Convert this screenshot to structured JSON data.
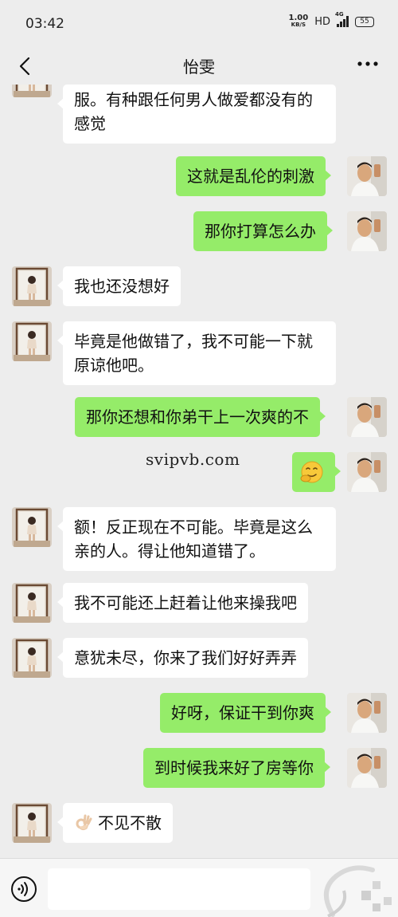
{
  "status": {
    "time": "03:42",
    "net_speed_value": "1.00",
    "net_speed_unit": "KB/S",
    "hd": "HD",
    "network": "4G",
    "battery": "55"
  },
  "header": {
    "title": "怡雯",
    "back_icon": "chevron-left-icon",
    "more_icon": "more-dots-icon"
  },
  "messages": [
    {
      "side": "left",
      "lines": [
        "服。有种跟任何男人做爱都没有的",
        "感觉"
      ]
    },
    {
      "side": "right",
      "lines": [
        "这就是乱伦的刺激"
      ]
    },
    {
      "side": "right",
      "lines": [
        "那你打算怎么办"
      ]
    },
    {
      "side": "left",
      "lines": [
        "我也还没想好"
      ]
    },
    {
      "side": "left",
      "lines": [
        "毕竟是他做错了，我不可能一下就",
        "原谅他吧。"
      ]
    },
    {
      "side": "right",
      "lines": [
        "那你还想和你弟干上一次爽的不"
      ]
    },
    {
      "side": "right",
      "lines": [
        ""
      ],
      "emoji": "smirk-face-emoji"
    },
    {
      "side": "left",
      "lines": [
        "额！反正现在不可能。毕竟是这么",
        "亲的人。得让他知道错了。"
      ]
    },
    {
      "side": "left",
      "lines": [
        "我不可能还上赶着让他来操我吧"
      ]
    },
    {
      "side": "left",
      "lines": [
        "意犹未尽，你来了我们好好弄弄"
      ]
    },
    {
      "side": "right",
      "lines": [
        "好呀，保证干到你爽"
      ]
    },
    {
      "side": "right",
      "lines": [
        "到时候我来好了房等你"
      ]
    },
    {
      "side": "left",
      "lines": [
        "不见不散"
      ],
      "emoji": "ok-hand-emoji"
    }
  ],
  "watermark_text": "svipvb.com",
  "input": {
    "placeholder": "",
    "voice_icon": "voice-icon"
  },
  "colors": {
    "background": "#ededed",
    "sent_bubble": "#95ec69",
    "received_bubble": "#ffffff"
  }
}
